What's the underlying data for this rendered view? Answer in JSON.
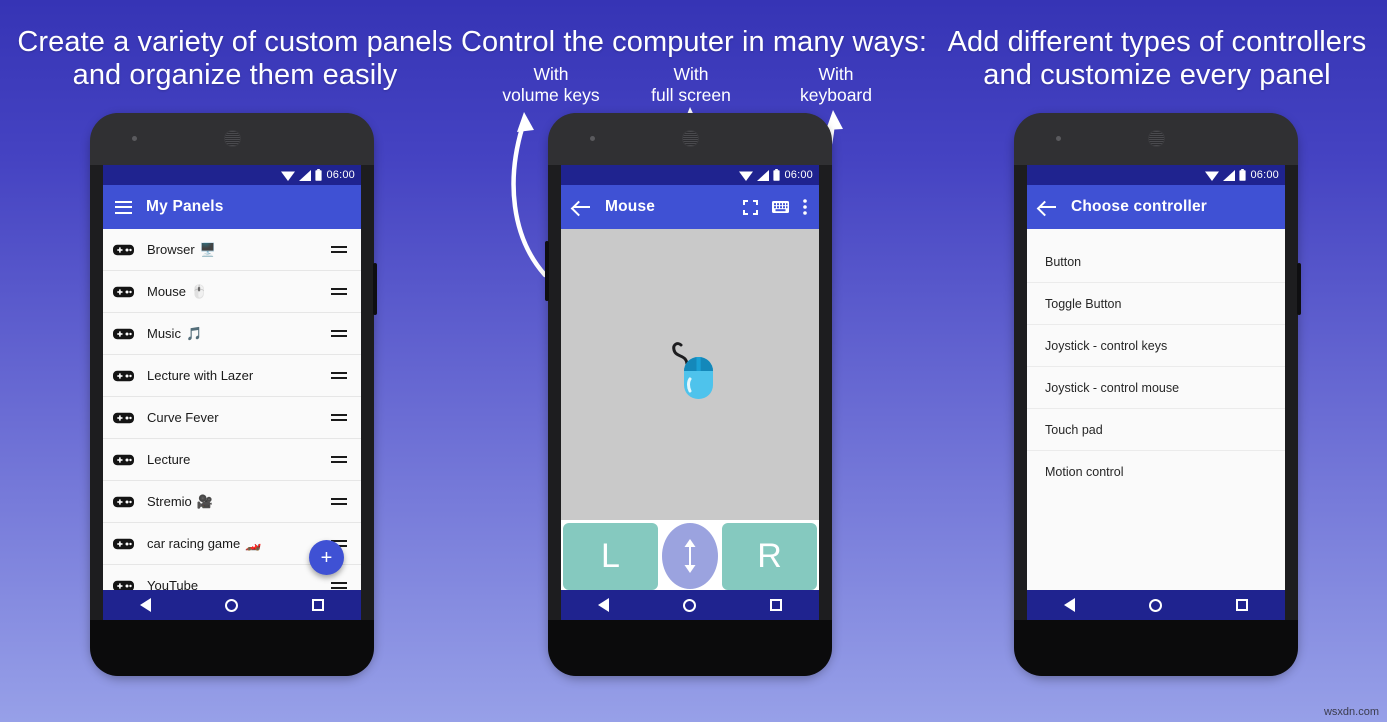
{
  "headings": {
    "left": "Create a variety of custom panels and organize them easily",
    "middle": "Control the computer in many ways:",
    "right": "Add different types of controllers and customize every panel"
  },
  "callouts": [
    {
      "id": "volume-keys",
      "line1": "With",
      "line2": "volume keys"
    },
    {
      "id": "full-screen",
      "line1": "With",
      "line2": "full screen"
    },
    {
      "id": "keyboard",
      "line1": "With",
      "line2": "keyboard"
    }
  ],
  "phones": {
    "left": {
      "status": {
        "time": "06:00",
        "icons": [
          "wifi-icon",
          "signal-icon",
          "battery-icon"
        ]
      },
      "appbar": {
        "title": "My Panels",
        "menu_icon": "hamburger-menu-icon"
      },
      "fab_label": "+",
      "panels": [
        {
          "name": "Browser",
          "emoji": "🖥️"
        },
        {
          "name": "Mouse",
          "emoji": "🖱️"
        },
        {
          "name": "Music",
          "emoji": "🎵"
        },
        {
          "name": "Lecture with Lazer",
          "emoji": ""
        },
        {
          "name": "Curve Fever",
          "emoji": ""
        },
        {
          "name": "Lecture",
          "emoji": ""
        },
        {
          "name": "Stremio",
          "emoji": "🎥"
        },
        {
          "name": "car racing game",
          "emoji": "🏎️"
        },
        {
          "name": "YouTube",
          "emoji": ""
        }
      ],
      "navbar": [
        "back-icon",
        "home-icon",
        "recents-icon"
      ]
    },
    "middle": {
      "status": {
        "time": "06:00",
        "icons": [
          "wifi-icon",
          "signal-icon",
          "battery-icon"
        ]
      },
      "appbar": {
        "title": "Mouse",
        "back_icon": "back-arrow-icon",
        "actions": [
          "fullscreen-icon",
          "keyboard-icon",
          "overflow-menu-icon"
        ]
      },
      "touchpad_icon": "computer-mouse-illustration",
      "buttons": {
        "left": "L",
        "right": "R",
        "scroll_icon": "vertical-scroll-arrow-icon"
      },
      "navbar": [
        "back-icon",
        "home-icon",
        "recents-icon"
      ]
    },
    "right": {
      "status": {
        "time": "06:00",
        "icons": [
          "wifi-icon",
          "signal-icon",
          "battery-icon"
        ]
      },
      "appbar": {
        "title": "Choose controller",
        "back_icon": "back-arrow-icon"
      },
      "controllers": [
        "Button",
        "Toggle Button",
        "Joystick - control keys",
        "Joystick - control mouse",
        "Touch pad",
        "Motion control"
      ],
      "navbar": [
        "back-icon",
        "home-icon",
        "recents-icon"
      ]
    }
  },
  "watermark": "wsxdn.com",
  "colors": {
    "bg_top": "#3634b5",
    "bg_bottom": "#97a0e8",
    "appbar": "#3f51d4",
    "statusbar": "#1f238f",
    "accent_button": "#85c9bf",
    "scroll_pill": "#9ba3df",
    "touchpad": "#c9c9c9"
  }
}
